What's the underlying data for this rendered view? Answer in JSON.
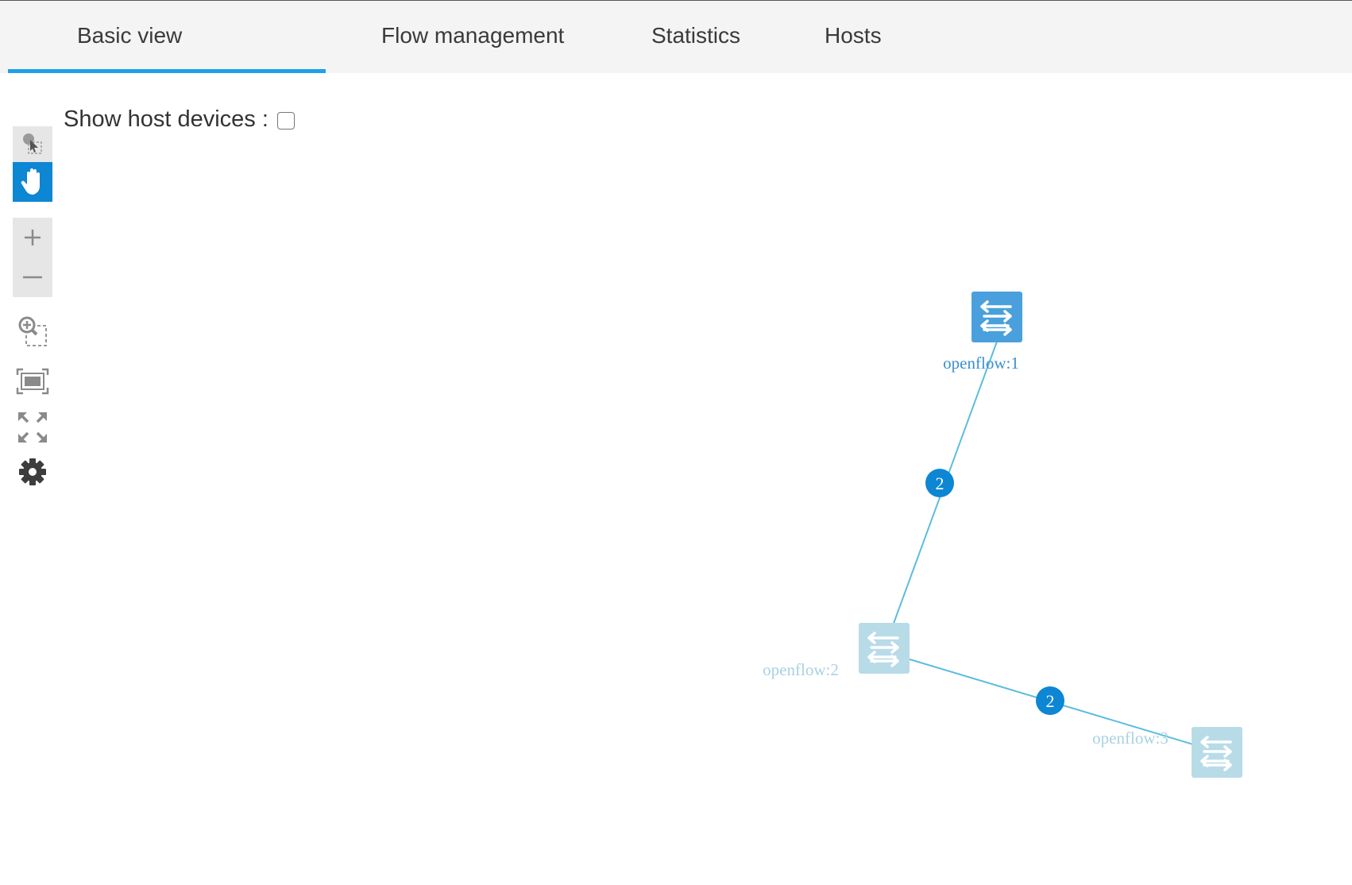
{
  "tabs": [
    {
      "label": "Basic view",
      "active": true
    },
    {
      "label": "Flow management",
      "active": false
    },
    {
      "label": "Statistics",
      "active": false
    },
    {
      "label": "Hosts",
      "active": false
    }
  ],
  "options": {
    "show_host_label": "Show host devices :",
    "show_host_checked": false
  },
  "toolbar": [
    {
      "name": "select-mode-icon",
      "active": false
    },
    {
      "name": "pan-mode-icon",
      "active": true
    },
    {
      "name": "zoom-in-icon"
    },
    {
      "name": "zoom-out-icon"
    },
    {
      "name": "zoom-by-selection-icon"
    },
    {
      "name": "fit-to-screen-icon"
    },
    {
      "name": "fullscreen-icon"
    },
    {
      "name": "settings-gear-icon"
    }
  ],
  "topology": {
    "nodes": [
      {
        "id": "openflow:1",
        "label": "openflow:1",
        "selected": true
      },
      {
        "id": "openflow:2",
        "label": "openflow:2",
        "selected": false
      },
      {
        "id": "openflow:3",
        "label": "openflow:3",
        "selected": false
      }
    ],
    "links": [
      {
        "source": "openflow:1",
        "target": "openflow:2",
        "count": "2"
      },
      {
        "source": "openflow:2",
        "target": "openflow:3",
        "count": "2"
      }
    ]
  },
  "colors": {
    "accent": "#0d86d3",
    "tab_underline": "#1ea1e8",
    "node_selected": "#4aa0dc",
    "node_faded": "#b8dbe8",
    "link": "#5bbde0",
    "label_selected": "#3b8fd1",
    "label_faded": "#a8d2e2"
  }
}
